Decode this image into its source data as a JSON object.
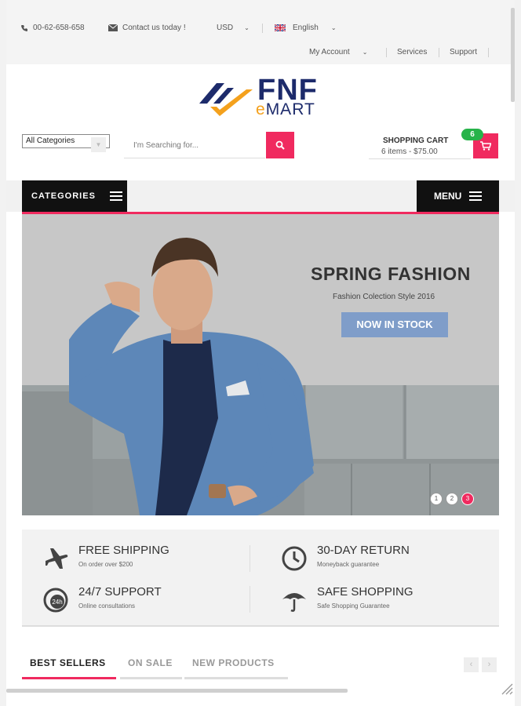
{
  "topbar": {
    "phone": "00-62-658-658",
    "contact": "Contact us today !",
    "currency": "USD",
    "language": "English",
    "my_account": "My Account",
    "services": "Services",
    "support": "Support"
  },
  "logo": {
    "fnf": "FNF",
    "e": "e",
    "mart": "MART"
  },
  "search": {
    "category_selected": "All Categories",
    "placeholder": "I'm Searching for..."
  },
  "cart": {
    "title": "SHOPPING CART",
    "summary": "6 items - $75.00",
    "count": "6"
  },
  "nav": {
    "categories": "CATEGORIES",
    "menu": "MENU"
  },
  "banner": {
    "title": "SPRING FASHION",
    "subtitle": "Fashion Colection Style 2016",
    "cta": "NOW IN STOCK",
    "slides": [
      "1",
      "2",
      "3"
    ],
    "active_slide": 3
  },
  "features": [
    {
      "title": "FREE SHIPPING",
      "sub": "On order over $200",
      "icon": "airplane-icon"
    },
    {
      "title": "30-DAY RETURN",
      "sub": "Moneyback guarantee",
      "icon": "clock-icon"
    },
    {
      "title": "24/7 SUPPORT",
      "sub": "Online consultations",
      "icon": "support-24h-icon"
    },
    {
      "title": "SAFE SHOPPING",
      "sub": "Safe Shopping Guarantee",
      "icon": "umbrella-icon"
    }
  ],
  "tabs": {
    "best_sellers": "BEST SELLERS",
    "on_sale": "ON SALE",
    "new_products": "NEW PRODUCTS"
  },
  "colors": {
    "accent": "#f02a5f",
    "brand_blue": "#1d2b6b",
    "brand_orange": "#f4a11d",
    "badge_green": "#27b34a",
    "cta_blue": "#7f9dc9"
  }
}
